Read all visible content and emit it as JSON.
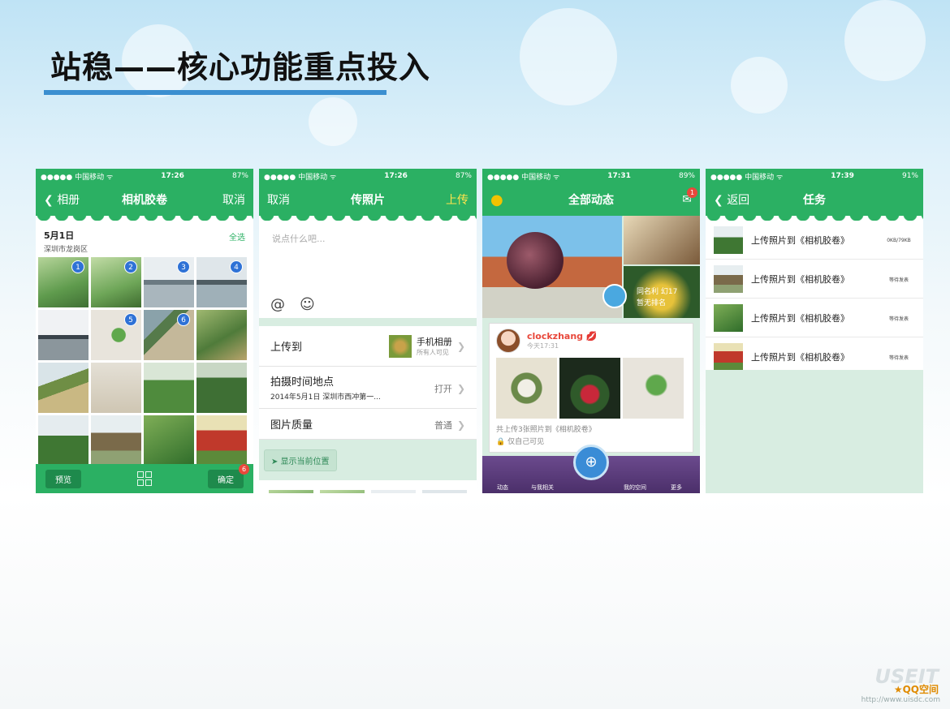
{
  "slide": {
    "title": "站稳——核心功能重点投入",
    "watermark_url": "http://www.uisdc.com",
    "watermark_big": "USEIT",
    "corner_logo": "QQ空间"
  },
  "phone1": {
    "status": {
      "carrier": "●●●●● 中国移动 ᯤ",
      "time": "17:26",
      "battery": "87%"
    },
    "nav": {
      "back": "相册",
      "title": "相机胶卷",
      "right": "取消"
    },
    "date": "5月1日",
    "location": "深圳市龙岗区",
    "select_all": "全选",
    "badges": [
      "1",
      "2",
      "3",
      "4",
      "5",
      "6"
    ],
    "footer": {
      "preview": "预览",
      "confirm": "确定",
      "confirm_badge": "6"
    }
  },
  "phone2": {
    "status": {
      "carrier": "●●●●● 中国移动 ᯤ",
      "time": "17:26",
      "battery": "87%"
    },
    "nav": {
      "left": "取消",
      "title": "传照片",
      "right": "上传"
    },
    "placeholder": "说点什么吧...",
    "upload_to": {
      "label": "上传到",
      "album": "手机相册",
      "visibility": "所有人可见"
    },
    "time_place": {
      "label": "拍摄时间地点",
      "detail": "2014年5月1日 深圳市西冲第一...",
      "value": "打开"
    },
    "quality": {
      "label": "图片质量",
      "value": "普通"
    },
    "show_location": "显示当前位置"
  },
  "phone3": {
    "status": {
      "carrier": "●●●●● 中国移动 ᯤ",
      "time": "17:31",
      "battery": "89%"
    },
    "nav": {
      "title": "全部动态",
      "mail_badge": "1"
    },
    "banner_text1": "同名利 幻17",
    "banner_text2": "暂无排名",
    "user": "clockzhang",
    "time": "今天17:31",
    "caption": "共上传3张照片到《相机胶卷》",
    "privacy": "仅自己可见",
    "tabs": [
      "动态",
      "与我相关",
      "我的空间",
      "更多"
    ]
  },
  "phone4": {
    "status": {
      "carrier": "●●●●● 中国移动 ᯤ",
      "time": "17:39",
      "battery": "91%"
    },
    "nav": {
      "back": "返回",
      "title": "任务"
    },
    "tasks": [
      {
        "text": "上传照片到《相机胶卷》",
        "status": "0KB/79KB"
      },
      {
        "text": "上传照片到《相机胶卷》",
        "status": "等待发表"
      },
      {
        "text": "上传照片到《相机胶卷》",
        "status": "等待发表"
      },
      {
        "text": "上传照片到《相机胶卷》",
        "status": "等待发表"
      }
    ]
  }
}
